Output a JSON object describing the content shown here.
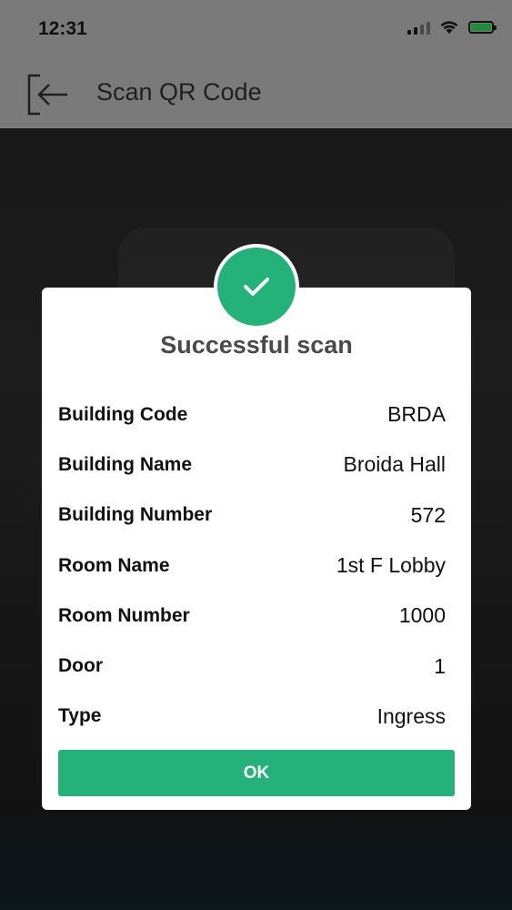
{
  "status_bar": {
    "time": "12:31",
    "icons": [
      "signal-icon",
      "wifi-icon",
      "battery-charging-icon"
    ]
  },
  "app_bar": {
    "title": "Scan QR Code",
    "back_icon": "exit-arrow-icon"
  },
  "dialog": {
    "badge_icon": "checkmark-icon",
    "title": "Successful scan",
    "rows": [
      {
        "label": "Building Code",
        "value": "BRDA"
      },
      {
        "label": "Building Name",
        "value": "Broida Hall"
      },
      {
        "label": "Building Number",
        "value": "572"
      },
      {
        "label": "Room Name",
        "value": "1st F Lobby"
      },
      {
        "label": "Room Number",
        "value": "1000"
      },
      {
        "label": "Door",
        "value": "1"
      },
      {
        "label": "Type",
        "value": "Ingress"
      }
    ],
    "ok_label": "OK"
  },
  "colors": {
    "accent": "#25b27a",
    "overlay_header": "#7a7a7a",
    "dialog_bg": "#ffffff",
    "title_text": "#4a4a4a"
  }
}
